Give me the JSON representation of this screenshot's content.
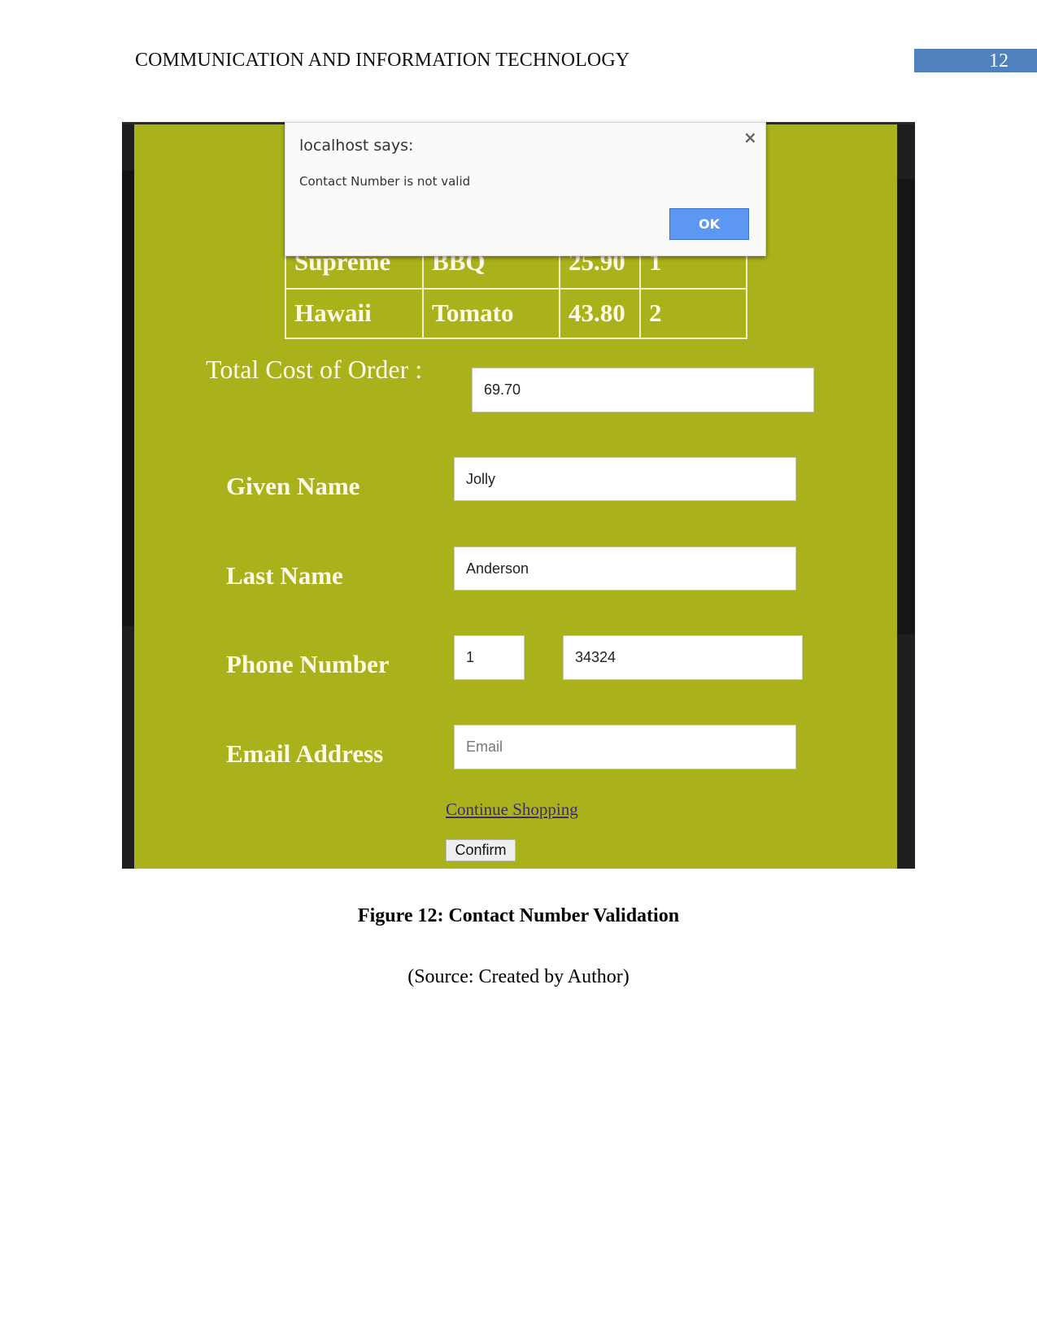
{
  "document": {
    "running_header": "COMMUNICATION AND INFORMATION TECHNOLOGY",
    "page_number": "12",
    "figure_caption": "Figure 12: Contact Number Validation",
    "figure_source": "(Source: Created by Author)"
  },
  "screenshot": {
    "colors": {
      "page_background": "#aab21b",
      "label_text": "#fffbe9",
      "ok_button": "#5b97f3",
      "link": "#3d2a7a"
    },
    "order_table": {
      "rows": [
        [
          "Supreme",
          "BBQ",
          "25.90",
          "1"
        ],
        [
          "Hawaii",
          "Tomato",
          "43.80",
          "2"
        ]
      ]
    },
    "total": {
      "label": "Total Cost of Order :",
      "value": "69.70"
    },
    "form": {
      "given_name": {
        "label": "Given Name",
        "value": "Jolly"
      },
      "last_name": {
        "label": "Last Name",
        "value": "Anderson"
      },
      "phone": {
        "label": "Phone Number",
        "code_value": "1",
        "number_value": "34324"
      },
      "email": {
        "label": "Email Address",
        "value": "",
        "placeholder": "Email"
      },
      "continue_link": "Continue Shopping",
      "confirm_button": "Confirm"
    },
    "alert_dialog": {
      "title": "localhost says:",
      "message": "Contact Number is not valid",
      "close_icon": "close-icon",
      "close_glyph": "×",
      "ok_label": "OK"
    }
  }
}
